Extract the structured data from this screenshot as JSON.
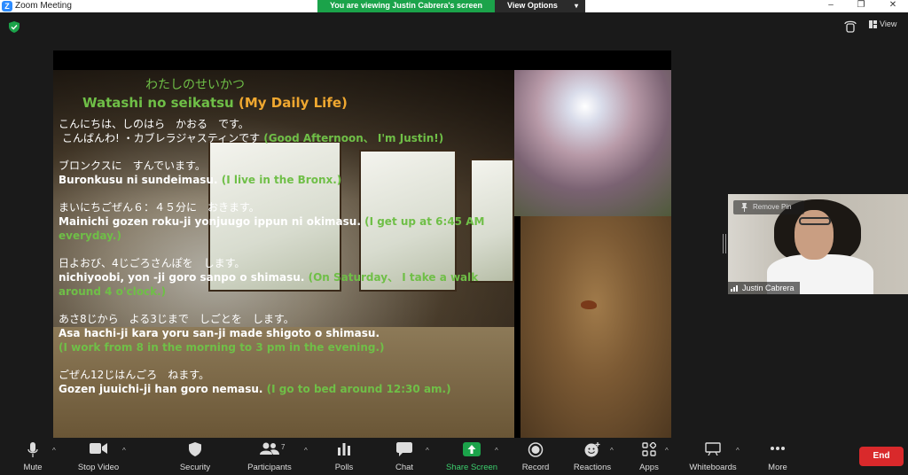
{
  "window": {
    "title": "Zoom Meeting",
    "app_icon": "zoom-logo-icon",
    "controls": {
      "minimize": "–",
      "maximize": "❐",
      "close": "✕"
    }
  },
  "banner": {
    "viewing_text": "You are viewing Justin Cabrera's screen",
    "view_options_label": "View Options",
    "color": "#1ba34a"
  },
  "top_right": {
    "view_label": "View"
  },
  "slide": {
    "title_jp": "わたしのせいかつ",
    "title_romaji": "Watashi no seikatsu",
    "title_en": "(My Daily Life)",
    "paragraphs": [
      {
        "jp": "こんにちは、しのはら　かおる　です。",
        "line2_jp": "こんばんわ! ・カブレラジャスティンです",
        "en": "(Good Afternoon、 I'm Justin!)"
      },
      {
        "jp": "ブロンクスに　すんでいます。",
        "romaji": "Buronkusu ni sundeimasu.",
        "en": "(I live in the Bronx.)"
      },
      {
        "jp": "まいにちごぜん６：４５分に　おきます。",
        "romaji": "Mainichi gozen roku-ji yonjuugo ippun ni okimasu.",
        "en": "(I get up at 6:45 AM everyday.)"
      },
      {
        "jp": "日よおび、4じごろさんぽを　します。",
        "romaji": "nichiyoobi, yon -ji goro sanpo o shimasu.",
        "en": "(On Saturday、 I take a walk around 4 o'clock.)"
      },
      {
        "jp": "あさ8じから　よる3じまで　しごとを　します。",
        "romaji": "Asa hachi-ji kara yoru san-ji made shigoto o shimasu.",
        "en": "(I work from 8 in the morning to 3 pm in the evening.)"
      },
      {
        "jp": "ごぜん12じはんごろ　ねます。",
        "romaji": "Gozen juuichi-ji han goro nemasu.",
        "en": "(I go to bed around 12:30 am.)"
      }
    ]
  },
  "participant_tile": {
    "name": "Justin Cabrera",
    "remove_pin_label": "Remove Pin"
  },
  "toolbar": {
    "items": [
      {
        "label": "Mute",
        "icon": "microphone-icon"
      },
      {
        "label": "Stop Video",
        "icon": "video-camera-icon"
      },
      {
        "label": "Security",
        "icon": "shield-icon"
      },
      {
        "label": "Participants",
        "icon": "participants-icon",
        "count": "7"
      },
      {
        "label": "Polls",
        "icon": "polls-icon"
      },
      {
        "label": "Chat",
        "icon": "chat-icon"
      },
      {
        "label": "Share Screen",
        "icon": "share-screen-icon",
        "accent": "#1ba34a"
      },
      {
        "label": "Record",
        "icon": "record-icon"
      },
      {
        "label": "Reactions",
        "icon": "reactions-icon"
      },
      {
        "label": "Apps",
        "icon": "apps-icon"
      },
      {
        "label": "Whiteboards",
        "icon": "whiteboard-icon"
      },
      {
        "label": "More",
        "icon": "more-icon"
      }
    ],
    "end_label": "End",
    "end_color": "#d9292b"
  }
}
